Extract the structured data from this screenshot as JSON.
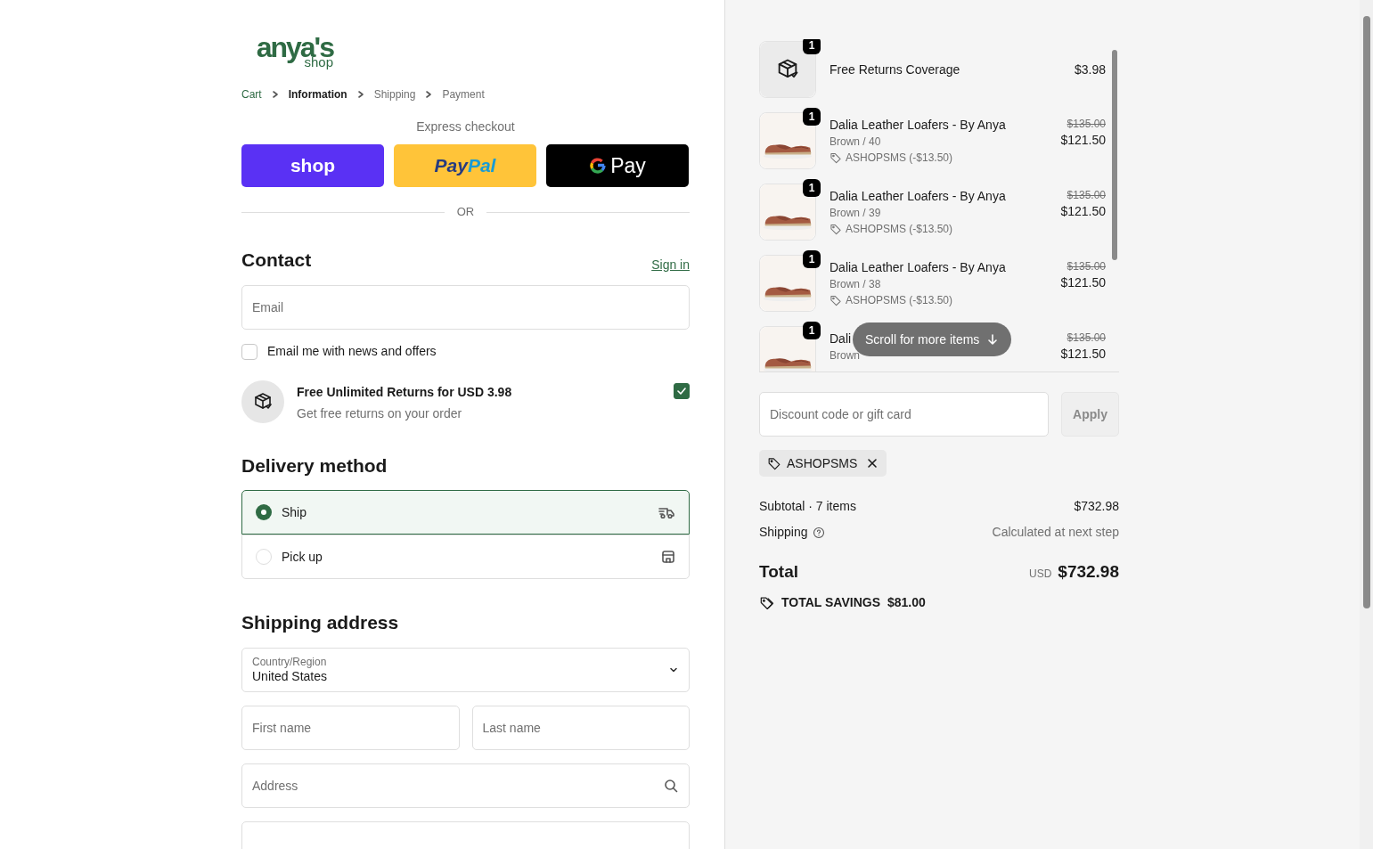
{
  "logo": {
    "main": "anya's",
    "sub": "shop"
  },
  "breadcrumbs": [
    {
      "label": "Cart",
      "selected": false,
      "kind": "link"
    },
    {
      "label": "Information",
      "selected": true,
      "kind": "current"
    },
    {
      "label": "Shipping",
      "selected": false,
      "kind": "future"
    },
    {
      "label": "Payment",
      "selected": false,
      "kind": "future"
    }
  ],
  "express_checkout": {
    "title": "Express checkout",
    "buttons": [
      {
        "kind": "shop",
        "label": "shop"
      },
      {
        "kind": "paypal",
        "label": "Pay",
        "label_2": "Pal"
      },
      {
        "kind": "gpay",
        "label": "Pay"
      }
    ],
    "divider": "OR"
  },
  "contact": {
    "heading": "Contact",
    "sign_in": "Sign in",
    "email": {
      "placeholder": "Email"
    },
    "newsletter": {
      "label": "Email me with news and offers",
      "checked": false
    }
  },
  "returns_offer": {
    "title": "Free Unlimited Returns for USD 3.98",
    "subtitle": "Get free returns on your order",
    "checked": true
  },
  "delivery": {
    "heading": "Delivery method",
    "options": [
      {
        "label": "Ship",
        "kind": "ship",
        "selected": true
      },
      {
        "label": "Pick up",
        "kind": "pickup",
        "selected": false
      }
    ]
  },
  "shipping_address": {
    "heading": "Shipping address",
    "country": {
      "label": "Country/Region",
      "value": "United States"
    },
    "first_name": {
      "placeholder": "First name"
    },
    "last_name": {
      "placeholder": "Last name"
    },
    "address": {
      "placeholder": "Address"
    }
  },
  "order_items": [
    {
      "kind": "coverage",
      "quantity": "1",
      "title": "Free Returns Coverage",
      "price": "$3.98"
    },
    {
      "kind": "product",
      "quantity": "1",
      "title": "Dalia Leather Loafers - By Anya",
      "variant": "Brown / 40",
      "discount": "ASHOPSMS (-$13.50)",
      "original_price": "$135.00",
      "price": "$121.50"
    },
    {
      "kind": "product",
      "quantity": "1",
      "title": "Dalia Leather Loafers - By Anya",
      "variant": "Brown / 39",
      "discount": "ASHOPSMS (-$13.50)",
      "original_price": "$135.00",
      "price": "$121.50"
    },
    {
      "kind": "product",
      "quantity": "1",
      "title": "Dalia Leather Loafers - By Anya",
      "variant": "Brown / 38",
      "discount": "ASHOPSMS (-$13.50)",
      "original_price": "$135.00",
      "price": "$121.50"
    },
    {
      "kind": "product",
      "quantity": "1",
      "title": "Dali",
      "variant": "Brown",
      "original_price": "$135.00",
      "price": "$121.50"
    }
  ],
  "scroll_hint": "Scroll for more items",
  "discount": {
    "placeholder": "Discount code or gift card",
    "apply": "Apply",
    "applied_code": "ASHOPSMS"
  },
  "summary": {
    "subtotal_label": "Subtotal · 7 items",
    "subtotal": "$732.98",
    "shipping_label": "Shipping",
    "shipping": "Calculated at next step",
    "total_label": "Total",
    "currency": "USD",
    "total": "$732.98",
    "savings_label": "TOTAL SAVINGS",
    "savings": "$81.00"
  }
}
